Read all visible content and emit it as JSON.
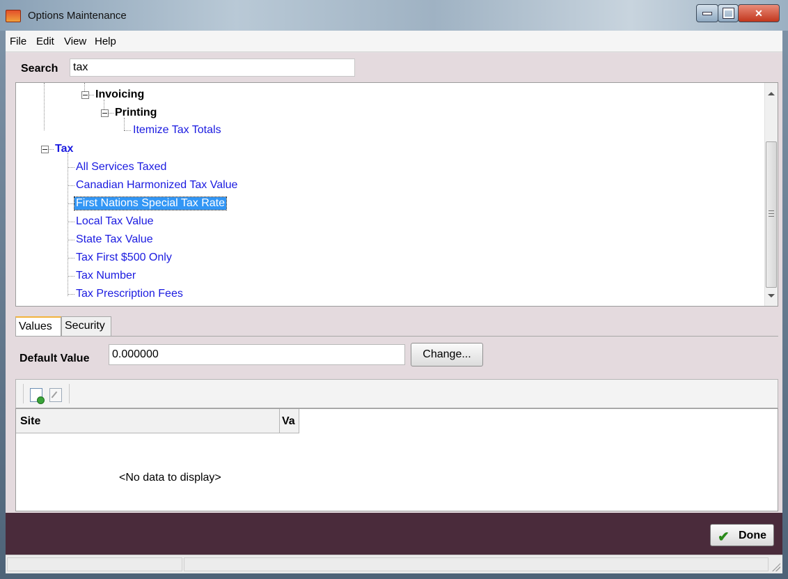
{
  "window": {
    "title": "Options Maintenance"
  },
  "menu": [
    "File",
    "Edit",
    "View",
    "Help"
  ],
  "search": {
    "label": "Search",
    "value": "tax"
  },
  "tree": {
    "invoicing": "Invoicing",
    "printing": "Printing",
    "itemize": "Itemize Tax Totals",
    "tax": "Tax",
    "tax_items": [
      "All Services Taxed",
      "Canadian Harmonized Tax Value",
      "First Nations Special Tax Rate",
      "Local Tax Value",
      "State Tax Value",
      "Tax First $500 Only",
      "Tax Number",
      "Tax Prescription Fees"
    ],
    "selected": "First Nations Special Tax Rate"
  },
  "tabs": [
    "Values",
    "Security"
  ],
  "default_value": {
    "label": "Default Value",
    "value": "0.000000",
    "change_label": "Change..."
  },
  "toolbar": {
    "icons": [
      "new-record-icon",
      "edit-record-icon"
    ]
  },
  "grid": {
    "columns": [
      "Site",
      "Va"
    ],
    "empty_text": "<No data to display>"
  },
  "footer": {
    "done_label": "Done"
  }
}
